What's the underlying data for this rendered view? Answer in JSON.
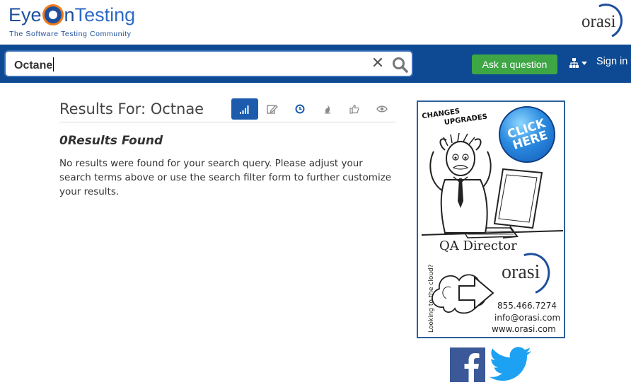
{
  "header": {
    "logo_text_eye": "Eye",
    "logo_text_on": "n",
    "logo_text_testing": "Testing",
    "logo_tagline": "The Software Testing Community",
    "partner_logo": "orasi"
  },
  "navbar": {
    "search_value": "Octane",
    "clear_icon": "close-icon",
    "search_icon": "search-icon",
    "ask_button": "Ask a question",
    "sitemap_icon": "sitemap-icon",
    "sign_in": "Sign in"
  },
  "results": {
    "title": "Results For: Octnae",
    "count_text": "0Results Found",
    "message": "No results were found for your search query. Please adjust your search terms above or use the search filter form to further customize your results.",
    "sort_tabs": [
      {
        "icon": "relevance-icon",
        "active": true
      },
      {
        "icon": "edit-icon",
        "active": false
      },
      {
        "icon": "clock-icon",
        "active": false
      },
      {
        "icon": "fire-icon",
        "active": false
      },
      {
        "icon": "thumbs-up-icon",
        "active": false
      },
      {
        "icon": "eye-icon",
        "active": false
      }
    ]
  },
  "ad": {
    "headline_1": "CHANGES",
    "headline_2": "UPGRADES",
    "click_badge": "CLICK HERE",
    "role": "QA Director",
    "side_text": "Looking to the cloud?",
    "brand": "orasi",
    "phone": "855.466.7274",
    "email": "info@orasi.com",
    "web": "www.orasi.com"
  },
  "social": {
    "facebook_icon": "facebook-icon",
    "twitter_icon": "twitter-icon"
  },
  "colors": {
    "navbar": "#0d4a93",
    "ask_button": "#3ea645",
    "active_tab": "#1d5cad",
    "brand_blue": "#1f4f9c"
  }
}
